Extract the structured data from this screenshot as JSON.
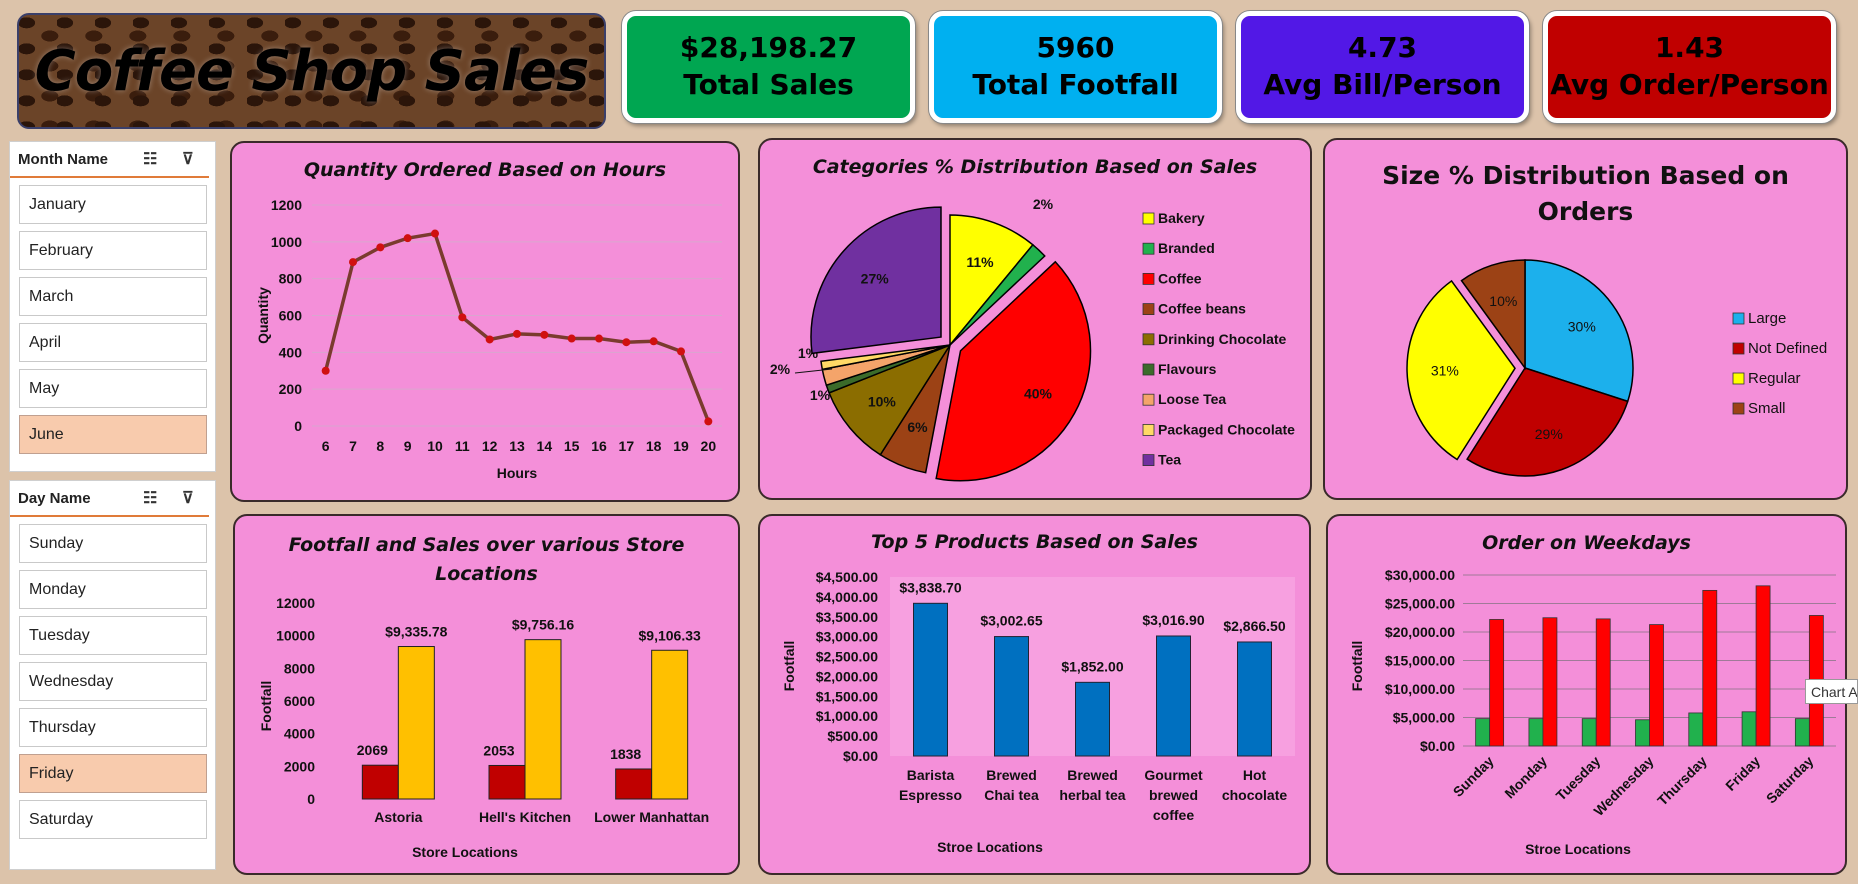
{
  "title": "Coffee Shop Sales",
  "kpis": [
    {
      "value": "$28,198.27",
      "label": "Total Sales",
      "color": "#00a651"
    },
    {
      "value": "5960",
      "label": "Total Footfall",
      "color": "#00b0f0"
    },
    {
      "value": "4.73",
      "label": "Avg Bill/Person",
      "color": "#5218e6"
    },
    {
      "value": "1.43",
      "label": "Avg Order/Person",
      "color": "#c00000"
    }
  ],
  "month_slicer": {
    "header": "Month Name",
    "items": [
      "January",
      "February",
      "March",
      "April",
      "May",
      "June"
    ],
    "selected": "June"
  },
  "day_slicer": {
    "header": "Day Name",
    "items": [
      "Sunday",
      "Monday",
      "Tuesday",
      "Wednesday",
      "Thursday",
      "Friday",
      "Saturday"
    ],
    "selected": "Friday"
  },
  "tooltip": "Chart A",
  "chart_data": [
    {
      "id": "hours",
      "type": "line",
      "title": "Quantity Ordered Based on Hours",
      "xlabel": "Hours",
      "ylabel": "Quantity",
      "x": [
        6,
        7,
        8,
        9,
        10,
        11,
        12,
        13,
        14,
        15,
        16,
        17,
        18,
        19,
        20
      ],
      "y": [
        300,
        890,
        970,
        1020,
        1045,
        590,
        470,
        500,
        495,
        475,
        475,
        455,
        460,
        405,
        25
      ],
      "ylim": [
        0,
        1200
      ],
      "yticks": [
        "0",
        "200",
        "400",
        "600",
        "800",
        "1000",
        "1200"
      ],
      "grid": true,
      "line_color": "#7a3b2e",
      "marker_color": "#d01010"
    },
    {
      "id": "categories",
      "type": "pie",
      "title": "Categories % Distribution Based on Sales",
      "labels": [
        "Bakery",
        "Branded",
        "Coffee",
        "Coffee beans",
        "Drinking Chocolate",
        "Flavours",
        "Loose Tea",
        "Packaged Chocolate",
        "Tea"
      ],
      "values": [
        11,
        2,
        40,
        6,
        10,
        1,
        2,
        1,
        27
      ],
      "data_labels": [
        "11%",
        "2%",
        "40%",
        "6%",
        "10%",
        "1%",
        "2%",
        "1%",
        "27%"
      ],
      "colors": [
        "#ffff00",
        "#21b14d",
        "#ff0000",
        "#9c4215",
        "#8b6d00",
        "#3b6b2a",
        "#f4a46a",
        "#ffd966",
        "#7030a0"
      ],
      "legend": "right"
    },
    {
      "id": "size",
      "type": "pie",
      "title": "Size % Distribution Based on Orders",
      "labels": [
        "Large",
        "Not Defined",
        "Regular",
        "Small"
      ],
      "values": [
        30,
        29,
        31,
        10
      ],
      "data_labels": [
        "30%",
        "29%",
        "31%",
        "10%"
      ],
      "colors": [
        "#1cb0ec",
        "#c00000",
        "#ffff00",
        "#9c4215"
      ],
      "legend": "right"
    },
    {
      "id": "stores",
      "type": "bar",
      "title": "Footfall and Sales over various Store Locations",
      "xlabel": "Store Locations",
      "ylabel": "Footfall",
      "categories": [
        "Astoria",
        "Hell's Kitchen",
        "Lower Manhattan"
      ],
      "series": [
        {
          "values": [
            2069,
            2053,
            1838
          ],
          "labels": [
            "2069",
            "2053",
            "1838"
          ],
          "color": "#c00000"
        },
        {
          "values": [
            9335.78,
            9756.16,
            9106.33
          ],
          "labels": [
            "$9,335.78",
            "$9,756.16",
            "$9,106.33"
          ],
          "color": "#ffc000"
        }
      ],
      "ylim": [
        0,
        12000
      ],
      "yticks": [
        "0",
        "2000",
        "4000",
        "6000",
        "8000",
        "10000",
        "12000"
      ]
    },
    {
      "id": "products",
      "type": "bar",
      "title": "Top 5 Products Based on Sales",
      "xlabel": "Stroe Locations",
      "ylabel": "Footfall",
      "categories": [
        [
          "Barista",
          "Espresso"
        ],
        [
          "Brewed",
          "Chai tea"
        ],
        [
          "Brewed",
          "herbal tea"
        ],
        [
          "Gourmet",
          "brewed",
          "coffee"
        ],
        [
          "Hot",
          "chocolate"
        ]
      ],
      "values": [
        3838.7,
        3002.65,
        1852.0,
        3016.9,
        2866.5
      ],
      "data_labels": [
        "$3,838.70",
        "$3,002.65",
        "$1,852.00",
        "$3,016.90",
        "$2,866.50"
      ],
      "ylim": [
        0,
        4500
      ],
      "yticks": [
        "$0.00",
        "$500.00",
        "$1,000.00",
        "$1,500.00",
        "$2,000.00",
        "$2,500.00",
        "$3,000.00",
        "$3,500.00",
        "$4,000.00",
        "$4,500.00"
      ],
      "bar_color": "#0070c0"
    },
    {
      "id": "weekdays",
      "type": "bar",
      "title": "Order on Weekdays",
      "xlabel": "Stroe Locations",
      "ylabel": "Footfall",
      "categories": [
        "Sunday",
        "Monday",
        "Tuesday",
        "Wednesday",
        "Thursday",
        "Friday",
        "Saturday"
      ],
      "series": [
        {
          "values": [
            4800,
            4800,
            4800,
            4600,
            5800,
            6000,
            4800
          ],
          "color": "#21b14d"
        },
        {
          "values": [
            22200,
            22500,
            22300,
            21300,
            27300,
            28100,
            22900
          ],
          "color": "#ff0000"
        }
      ],
      "ylim": [
        0,
        30000
      ],
      "yticks": [
        "$0.00",
        "$5,000.00",
        "$10,000.00",
        "$15,000.00",
        "$20,000.00",
        "$25,000.00",
        "$30,000.00"
      ],
      "grid": true
    }
  ]
}
